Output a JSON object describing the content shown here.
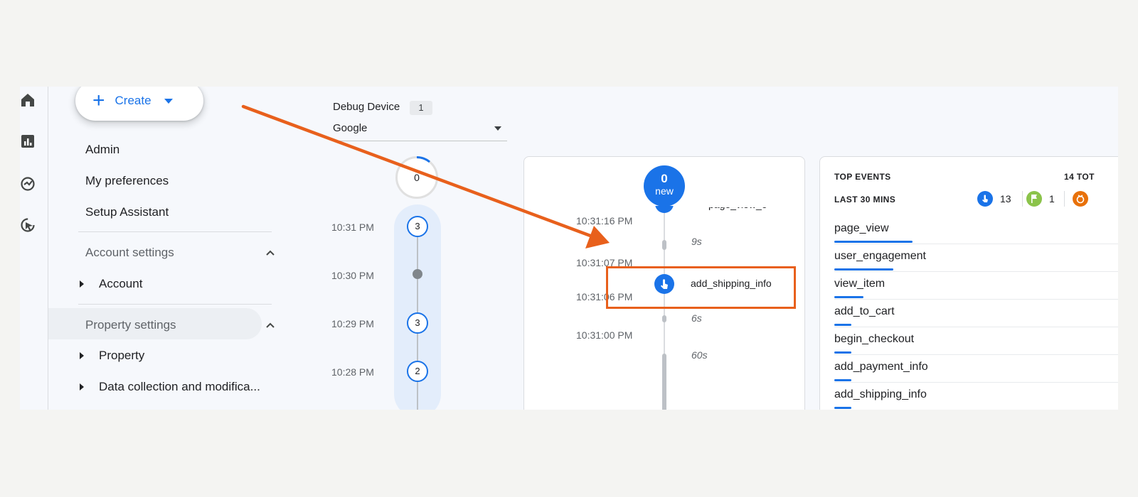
{
  "create_button": {
    "label": "Create"
  },
  "sidebar": {
    "items": [
      {
        "label": "Admin"
      },
      {
        "label": "My preferences"
      },
      {
        "label": "Setup Assistant"
      }
    ],
    "account_settings": {
      "label": "Account settings",
      "children": [
        {
          "label": "Account"
        }
      ]
    },
    "property_settings": {
      "label": "Property settings",
      "children": [
        {
          "label": "Property"
        },
        {
          "label": "Data collection and modifica..."
        }
      ]
    }
  },
  "debug_device": {
    "label": "Debug Device",
    "count": "1",
    "selected": "Google"
  },
  "minutes_stream": {
    "seconds_count": "0",
    "rows": [
      {
        "time": "10:31 PM",
        "count": "3"
      },
      {
        "time": "10:30 PM",
        "count": ""
      },
      {
        "time": "10:29 PM",
        "count": "3"
      },
      {
        "time": "10:28 PM",
        "count": "2"
      }
    ]
  },
  "seconds_stream": {
    "new_count": "0",
    "new_label": "new",
    "times": [
      "10:31:16 PM",
      "10:31:07 PM",
      "10:31:06 PM",
      "10:31:00 PM"
    ],
    "gaps": [
      "9s",
      "6s",
      "60s"
    ],
    "event": "add_shipping_info"
  },
  "top_events": {
    "title": "TOP EVENTS",
    "total": "14 TOT",
    "subtitle": "LAST 30 MINS",
    "stats": [
      {
        "icon": "touch-icon",
        "color": "#1a73e8",
        "value": "13"
      },
      {
        "icon": "flag-icon",
        "color": "#8bc34a",
        "value": "1"
      },
      {
        "icon": "error-icon",
        "color": "#e8710a",
        "value": ""
      }
    ],
    "events": [
      {
        "name": "page_view",
        "share": 0.32
      },
      {
        "name": "user_engagement",
        "share": 0.24
      },
      {
        "name": "view_item",
        "share": 0.12
      },
      {
        "name": "add_to_cart",
        "share": 0.07
      },
      {
        "name": "begin_checkout",
        "share": 0.07
      },
      {
        "name": "add_payment_info",
        "share": 0.07
      },
      {
        "name": "add_shipping_info",
        "share": 0.07
      }
    ]
  },
  "colors": {
    "accent": "#1a73e8",
    "annotation": "#e8601c"
  }
}
